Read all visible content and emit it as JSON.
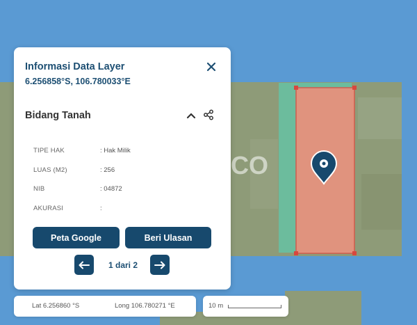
{
  "map": {
    "watermark": "CO",
    "colors": {
      "water": "#5b9bd4",
      "land": "#8f9c79",
      "parcel": "#e8917e",
      "strip": "#6cc3a6"
    }
  },
  "info": {
    "title": "Informasi Data Layer",
    "coords": "6.256858°S, 106.780033°E",
    "section": "Bidang Tanah",
    "rows": [
      {
        "key": "TIPE HAK",
        "value": ": Hak Milik"
      },
      {
        "key": "LUAS (M2)",
        "value": ": 256"
      },
      {
        "key": "NIB",
        "value": ": 04872"
      },
      {
        "key": "AKURASI",
        "value": ":"
      }
    ],
    "btn_google": "Peta Google",
    "btn_review": "Beri Ulasan",
    "pager": "1 dari 2"
  },
  "status": {
    "lat": "Lat 6.256860 °S",
    "long": "Long 106.780271 °E",
    "scale": "10 m"
  }
}
